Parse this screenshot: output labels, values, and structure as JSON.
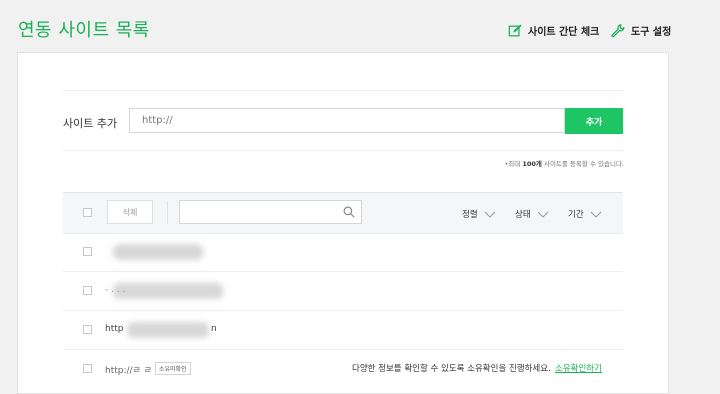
{
  "header": {
    "title": "연동 사이트 목록",
    "quick_check_label": "사이트 간단 체크",
    "settings_label": "도구 설정"
  },
  "add_site": {
    "label": "사이트 추가",
    "input_value": "",
    "input_placeholder": "http://",
    "button_label": "추가",
    "limit_prefix": "•최대",
    "limit_count": "100개",
    "limit_suffix": "사이트를 등록할 수 있습니다."
  },
  "toolbar": {
    "delete_label": "삭제",
    "search_value": "",
    "filters": [
      "정렬",
      "상태",
      "기간"
    ]
  },
  "rows": [
    {
      "text": ""
    },
    {
      "text": "- . . ."
    },
    {
      "text_left": "http",
      "text_right": "n"
    },
    {
      "text": "http://ㄹ ㄹ",
      "badge": "소유미확인",
      "message": "다양한 정보를 확인할 수 있도록 소유확인을 진행하세요.",
      "link": "소유확인하기"
    }
  ],
  "colors": {
    "accent": "#1ec564",
    "title": "#1ab056"
  }
}
